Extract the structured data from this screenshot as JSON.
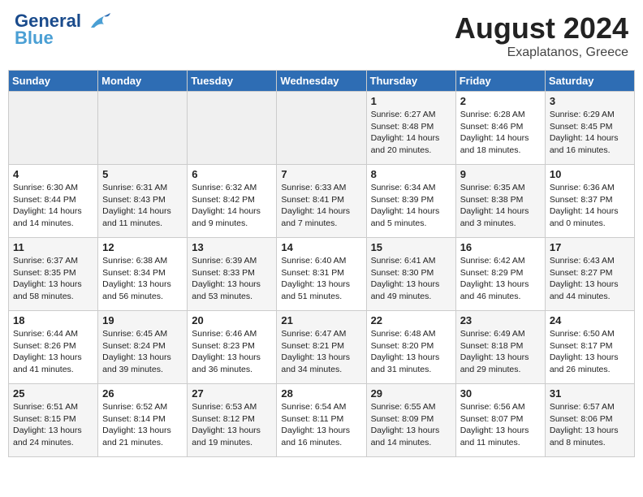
{
  "header": {
    "logo_line1": "General",
    "logo_line2": "Blue",
    "month_year": "August 2024",
    "location": "Exaplatanos, Greece"
  },
  "weekdays": [
    "Sunday",
    "Monday",
    "Tuesday",
    "Wednesday",
    "Thursday",
    "Friday",
    "Saturday"
  ],
  "weeks": [
    [
      {
        "day": "",
        "info": ""
      },
      {
        "day": "",
        "info": ""
      },
      {
        "day": "",
        "info": ""
      },
      {
        "day": "",
        "info": ""
      },
      {
        "day": "1",
        "info": "Sunrise: 6:27 AM\nSunset: 8:48 PM\nDaylight: 14 hours\nand 20 minutes."
      },
      {
        "day": "2",
        "info": "Sunrise: 6:28 AM\nSunset: 8:46 PM\nDaylight: 14 hours\nand 18 minutes."
      },
      {
        "day": "3",
        "info": "Sunrise: 6:29 AM\nSunset: 8:45 PM\nDaylight: 14 hours\nand 16 minutes."
      }
    ],
    [
      {
        "day": "4",
        "info": "Sunrise: 6:30 AM\nSunset: 8:44 PM\nDaylight: 14 hours\nand 14 minutes."
      },
      {
        "day": "5",
        "info": "Sunrise: 6:31 AM\nSunset: 8:43 PM\nDaylight: 14 hours\nand 11 minutes."
      },
      {
        "day": "6",
        "info": "Sunrise: 6:32 AM\nSunset: 8:42 PM\nDaylight: 14 hours\nand 9 minutes."
      },
      {
        "day": "7",
        "info": "Sunrise: 6:33 AM\nSunset: 8:41 PM\nDaylight: 14 hours\nand 7 minutes."
      },
      {
        "day": "8",
        "info": "Sunrise: 6:34 AM\nSunset: 8:39 PM\nDaylight: 14 hours\nand 5 minutes."
      },
      {
        "day": "9",
        "info": "Sunrise: 6:35 AM\nSunset: 8:38 PM\nDaylight: 14 hours\nand 3 minutes."
      },
      {
        "day": "10",
        "info": "Sunrise: 6:36 AM\nSunset: 8:37 PM\nDaylight: 14 hours\nand 0 minutes."
      }
    ],
    [
      {
        "day": "11",
        "info": "Sunrise: 6:37 AM\nSunset: 8:35 PM\nDaylight: 13 hours\nand 58 minutes."
      },
      {
        "day": "12",
        "info": "Sunrise: 6:38 AM\nSunset: 8:34 PM\nDaylight: 13 hours\nand 56 minutes."
      },
      {
        "day": "13",
        "info": "Sunrise: 6:39 AM\nSunset: 8:33 PM\nDaylight: 13 hours\nand 53 minutes."
      },
      {
        "day": "14",
        "info": "Sunrise: 6:40 AM\nSunset: 8:31 PM\nDaylight: 13 hours\nand 51 minutes."
      },
      {
        "day": "15",
        "info": "Sunrise: 6:41 AM\nSunset: 8:30 PM\nDaylight: 13 hours\nand 49 minutes."
      },
      {
        "day": "16",
        "info": "Sunrise: 6:42 AM\nSunset: 8:29 PM\nDaylight: 13 hours\nand 46 minutes."
      },
      {
        "day": "17",
        "info": "Sunrise: 6:43 AM\nSunset: 8:27 PM\nDaylight: 13 hours\nand 44 minutes."
      }
    ],
    [
      {
        "day": "18",
        "info": "Sunrise: 6:44 AM\nSunset: 8:26 PM\nDaylight: 13 hours\nand 41 minutes."
      },
      {
        "day": "19",
        "info": "Sunrise: 6:45 AM\nSunset: 8:24 PM\nDaylight: 13 hours\nand 39 minutes."
      },
      {
        "day": "20",
        "info": "Sunrise: 6:46 AM\nSunset: 8:23 PM\nDaylight: 13 hours\nand 36 minutes."
      },
      {
        "day": "21",
        "info": "Sunrise: 6:47 AM\nSunset: 8:21 PM\nDaylight: 13 hours\nand 34 minutes."
      },
      {
        "day": "22",
        "info": "Sunrise: 6:48 AM\nSunset: 8:20 PM\nDaylight: 13 hours\nand 31 minutes."
      },
      {
        "day": "23",
        "info": "Sunrise: 6:49 AM\nSunset: 8:18 PM\nDaylight: 13 hours\nand 29 minutes."
      },
      {
        "day": "24",
        "info": "Sunrise: 6:50 AM\nSunset: 8:17 PM\nDaylight: 13 hours\nand 26 minutes."
      }
    ],
    [
      {
        "day": "25",
        "info": "Sunrise: 6:51 AM\nSunset: 8:15 PM\nDaylight: 13 hours\nand 24 minutes."
      },
      {
        "day": "26",
        "info": "Sunrise: 6:52 AM\nSunset: 8:14 PM\nDaylight: 13 hours\nand 21 minutes."
      },
      {
        "day": "27",
        "info": "Sunrise: 6:53 AM\nSunset: 8:12 PM\nDaylight: 13 hours\nand 19 minutes."
      },
      {
        "day": "28",
        "info": "Sunrise: 6:54 AM\nSunset: 8:11 PM\nDaylight: 13 hours\nand 16 minutes."
      },
      {
        "day": "29",
        "info": "Sunrise: 6:55 AM\nSunset: 8:09 PM\nDaylight: 13 hours\nand 14 minutes."
      },
      {
        "day": "30",
        "info": "Sunrise: 6:56 AM\nSunset: 8:07 PM\nDaylight: 13 hours\nand 11 minutes."
      },
      {
        "day": "31",
        "info": "Sunrise: 6:57 AM\nSunset: 8:06 PM\nDaylight: 13 hours\nand 8 minutes."
      }
    ]
  ]
}
